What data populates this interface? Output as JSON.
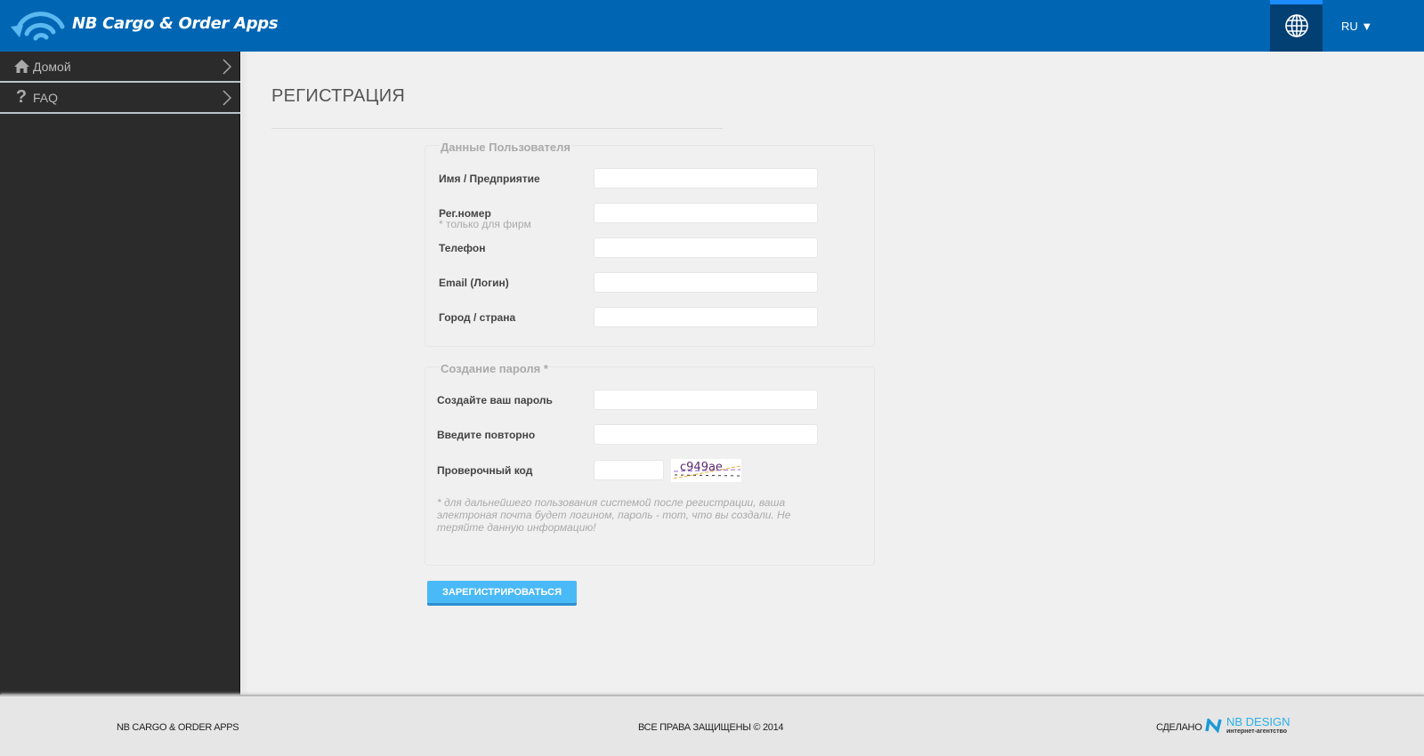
{
  "header": {
    "app_title": "NB Cargo & Order Apps",
    "language": "RU",
    "globe_icon": "globe-icon",
    "accent": "#0066b3"
  },
  "sidebar": {
    "items": [
      {
        "label": "Домой",
        "icon": "home-icon"
      },
      {
        "label": "FAQ",
        "icon": "question-icon"
      }
    ]
  },
  "page": {
    "title": "РЕГИСТРАЦИЯ"
  },
  "user_data": {
    "legend": "Данные Пользователя",
    "fields": [
      {
        "label": "Имя / Предприятие",
        "value": ""
      },
      {
        "label": "Рег.номер",
        "hint": "* только для фирм",
        "value": ""
      },
      {
        "label": "Телефон",
        "value": ""
      },
      {
        "label": "Email (Логин)",
        "value": ""
      },
      {
        "label": "Город / страна",
        "value": ""
      }
    ]
  },
  "password": {
    "legend": "Создание пароля *",
    "fields": [
      {
        "label": "Создайте ваш пароль",
        "value": ""
      },
      {
        "label": "Введите повторно",
        "value": ""
      },
      {
        "label": "Проверочный код",
        "value": ""
      }
    ],
    "captcha": "c949ae",
    "note": "* для дальнейшего пользования системой после регистрации, ваша электроная почта будет логином, пароль - тот, что вы создали. Не теряйте данную информацию!"
  },
  "submit_label": "ЗАРЕГИСТРИРОВАТЬСЯ",
  "footer": {
    "left": "NB CARGO & ORDER APPS",
    "center": "ВСЕ ПРАВА ЗАЩИЩЕНЫ © 2014",
    "made_by": "СДЕЛАНО",
    "brand": "NB DESIGN",
    "brand_sub": "интернет-агентство"
  }
}
